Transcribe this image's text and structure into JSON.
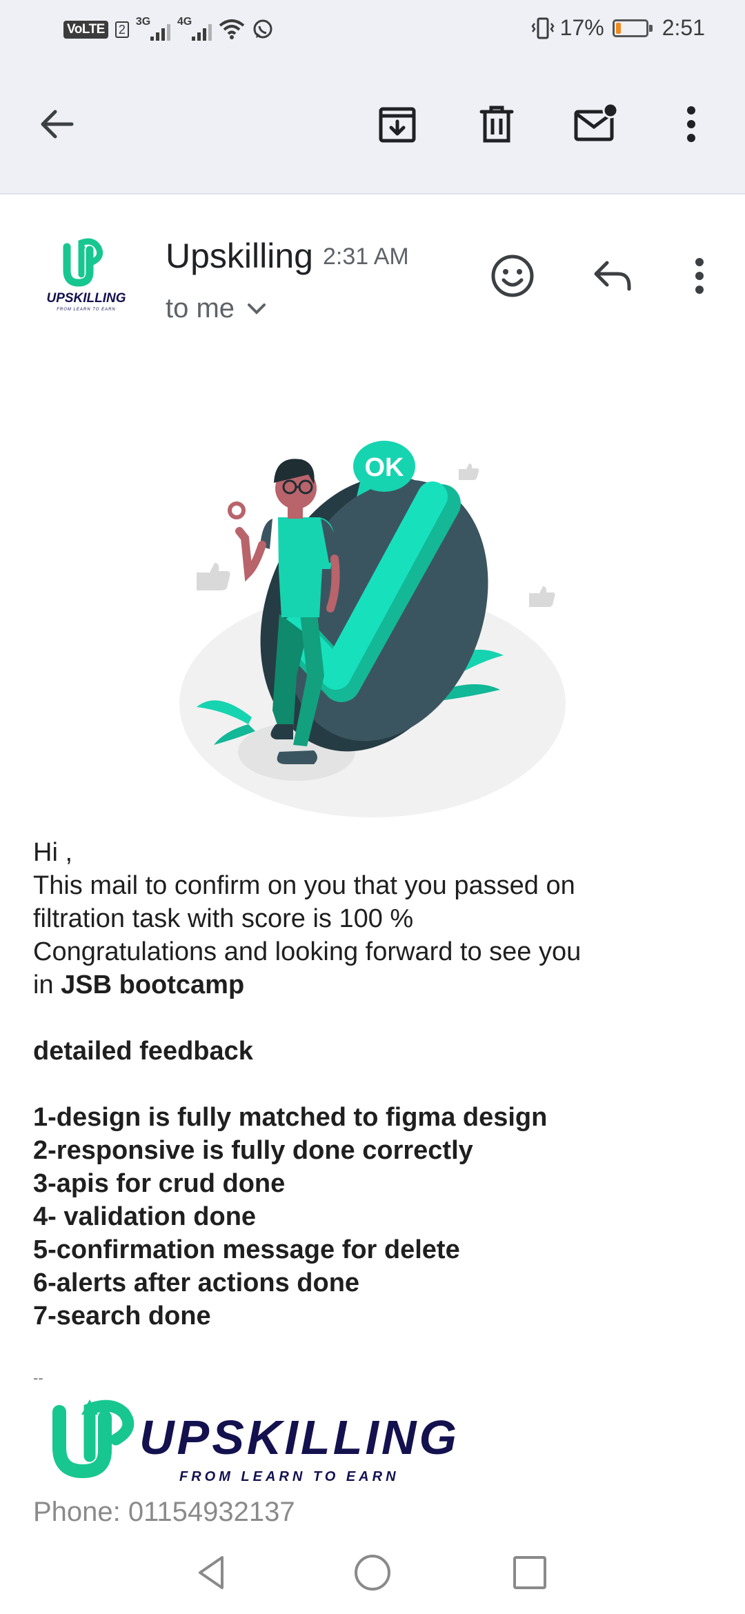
{
  "status_bar": {
    "volte": "VoLTE",
    "sim": "2",
    "net1": "3G",
    "net2": "4G",
    "battery_percent": "17%",
    "battery_level": 0.17,
    "time": "2:51"
  },
  "toolbar": {
    "back": "arrow-back-icon",
    "archive": "archive-icon",
    "delete": "trash-icon",
    "mark_unread": "mail-unread-icon",
    "more": "more-vert-icon"
  },
  "email": {
    "sender": "Upskilling",
    "time": "2:31 AM",
    "recipient": "to me",
    "logo_text": "UPSKILLING",
    "logo_tagline": "FROM LEARN TO EARN",
    "illustration_text": "OK",
    "body": {
      "greeting": "Hi  ,",
      "line1": "This mail to confirm on you that you passed on",
      "line2": "filtration task with score is 100 %",
      "line3": "Congratulations and looking forward to see you",
      "line4_prefix": "in ",
      "line4_bold": "JSB bootcamp",
      "feedback_title": "detailed feedback",
      "items": [
        "1-design is fully matched to figma design",
        "2-responsive is fully done correctly",
        "3-apis for crud done",
        "4- validation done",
        "5-confirmation message for delete",
        "6-alerts after actions done",
        "7-search done"
      ]
    },
    "signature": {
      "separator": "--",
      "brand": "UPSKILLING",
      "tagline": "FROM LEARN TO EARN",
      "phone": "Phone: 01154932137"
    }
  },
  "nav": {
    "back": "nav-back-icon",
    "home": "nav-home-icon",
    "recents": "nav-recents-icon"
  }
}
